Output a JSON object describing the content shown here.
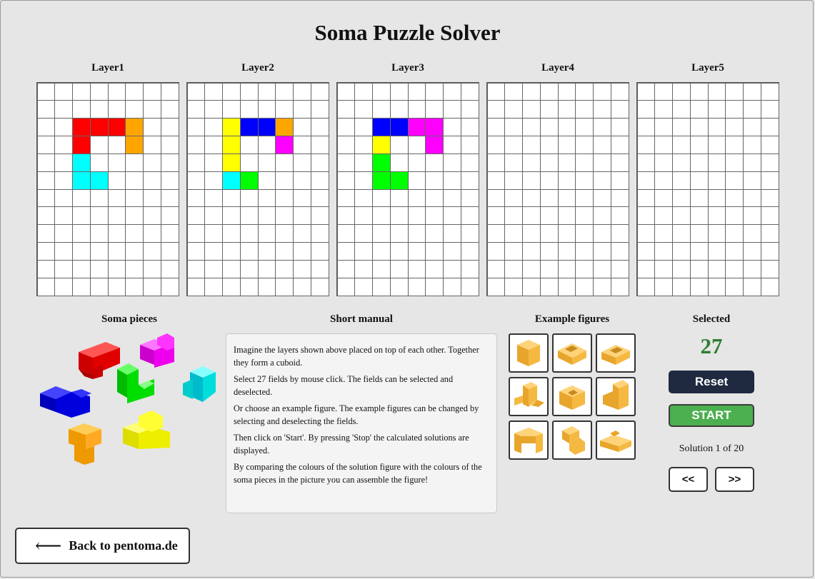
{
  "title": "Soma Puzzle Solver",
  "layers": [
    {
      "label": "Layer1",
      "cells": [
        {
          "r": 2,
          "c": 2,
          "color": "#ff0000"
        },
        {
          "r": 2,
          "c": 3,
          "color": "#ff0000"
        },
        {
          "r": 2,
          "c": 4,
          "color": "#ff0000"
        },
        {
          "r": 2,
          "c": 5,
          "color": "#ffa500"
        },
        {
          "r": 3,
          "c": 2,
          "color": "#ff0000"
        },
        {
          "r": 3,
          "c": 5,
          "color": "#ffa500"
        },
        {
          "r": 4,
          "c": 2,
          "color": "#00ffff"
        },
        {
          "r": 5,
          "c": 2,
          "color": "#00ffff"
        },
        {
          "r": 5,
          "c": 3,
          "color": "#00ffff"
        }
      ]
    },
    {
      "label": "Layer2",
      "cells": [
        {
          "r": 2,
          "c": 2,
          "color": "#ffff00"
        },
        {
          "r": 2,
          "c": 3,
          "color": "#0000ff"
        },
        {
          "r": 2,
          "c": 4,
          "color": "#0000ff"
        },
        {
          "r": 2,
          "c": 5,
          "color": "#ffa500"
        },
        {
          "r": 3,
          "c": 2,
          "color": "#ffff00"
        },
        {
          "r": 3,
          "c": 5,
          "color": "#ff00ff"
        },
        {
          "r": 4,
          "c": 2,
          "color": "#ffff00"
        },
        {
          "r": 5,
          "c": 2,
          "color": "#00ffff"
        },
        {
          "r": 5,
          "c": 3,
          "color": "#00ff00"
        }
      ]
    },
    {
      "label": "Layer3",
      "cells": [
        {
          "r": 2,
          "c": 2,
          "color": "#0000ff"
        },
        {
          "r": 2,
          "c": 3,
          "color": "#0000ff"
        },
        {
          "r": 2,
          "c": 4,
          "color": "#ff00ff"
        },
        {
          "r": 2,
          "c": 5,
          "color": "#ff00ff"
        },
        {
          "r": 3,
          "c": 2,
          "color": "#ffff00"
        },
        {
          "r": 3,
          "c": 5,
          "color": "#ff00ff"
        },
        {
          "r": 4,
          "c": 2,
          "color": "#00ff00"
        },
        {
          "r": 5,
          "c": 2,
          "color": "#00ff00"
        },
        {
          "r": 5,
          "c": 3,
          "color": "#00ff00"
        }
      ]
    },
    {
      "label": "Layer4",
      "cells": []
    },
    {
      "label": "Layer5",
      "cells": []
    }
  ],
  "grid": {
    "rows": 12,
    "cols": 8
  },
  "soma_pieces_label": "Soma pieces",
  "manual": {
    "heading": "Short manual",
    "paragraphs": [
      "Imagine the layers shown above placed on top of each other. Together they form a cuboid.",
      "Select 27 fields by mouse click. The fields can be selected and deselected.",
      "Or choose an example figure. The example figures can be changed by selecting and deselecting the fields.",
      "Then click on 'Start'. By pressing 'Stop' the calculated solutions are displayed.",
      "By comparing the colours of the solution figure with the colours of the soma pieces in the picture you can assemble the figure!"
    ]
  },
  "examples_label": "Example figures",
  "example_icons": [
    "cube-figure-icon",
    "bathtub-figure-icon",
    "steps-figure-icon",
    "crawler-figure-icon",
    "castle-figure-icon",
    "staircase-figure-icon",
    "arch-figure-icon",
    "twist-figure-icon",
    "cross-figure-icon"
  ],
  "selected": {
    "label": "Selected",
    "count": "27"
  },
  "buttons": {
    "reset": "Reset",
    "start": "START",
    "prev": "<<",
    "next": ">>"
  },
  "solution_text": "Solution 1 of 20",
  "back": {
    "arrow": "⟵",
    "label": "Back to pentoma.de"
  },
  "colors": {
    "count": "#2e7d32",
    "reset_bg": "#1f2a40",
    "start_bg": "#4caf50",
    "cube_gold": "#f5b942"
  }
}
